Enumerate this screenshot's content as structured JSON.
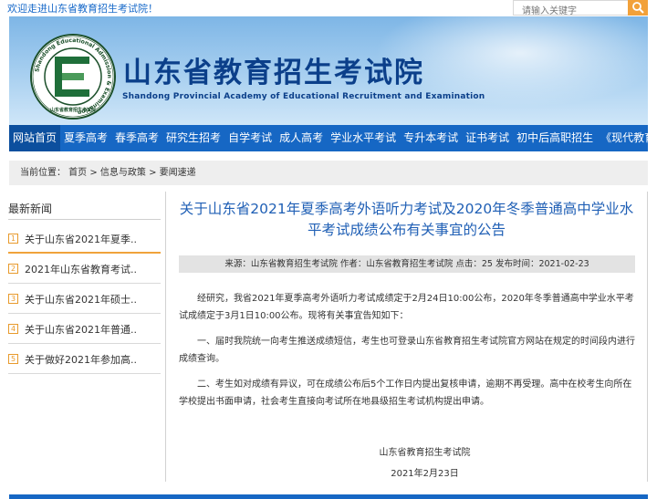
{
  "topbar": {
    "welcome": "欢迎走进山东省教育招生考试院！",
    "search_placeholder": "请输入关键字"
  },
  "header": {
    "title_cn": "山东省教育招生考试院",
    "title_en": "Shandong Provincial Academy of Educational Recruitment and Examination",
    "logo_ring_text": "Shandong Educational Admission & Examination",
    "logo_seal_text": "山东省教育招生考试院",
    "logo_letter": "E"
  },
  "nav": {
    "items": [
      "网站首页",
      "夏季高考",
      "春季高考",
      "研究生招考",
      "自学考试",
      "成人高考",
      "学业水平考试",
      "专升本考试",
      "证书考试",
      "初中后高职招生",
      "《现代教育》"
    ]
  },
  "breadcrumb": {
    "text": "当前位置：  首页 > 信息与政策 > 要闻速递"
  },
  "sidebar": {
    "title": "最新新闻",
    "items": [
      {
        "num": "1",
        "label": "关于山东省2021年夏季.."
      },
      {
        "num": "2",
        "label": "2021年山东省教育考试.."
      },
      {
        "num": "3",
        "label": "关于山东省2021年硕士.."
      },
      {
        "num": "4",
        "label": "关于山东省2021年普通.."
      },
      {
        "num": "5",
        "label": "关于做好2021年参加高.."
      }
    ]
  },
  "article": {
    "title": "关于山东省2021年夏季高考外语听力考试及2020年冬季普通高中学业水平考试成绩公布有关事宜的公告",
    "meta": "来源：山东省教育招生考试院  作者：山东省教育招生考试院  点击：25  发布时间：2021-02-23",
    "paragraphs": [
      "经研究，我省2021年夏季高考外语听力考试成绩定于2月24日10:00公布，2020年冬季普通高中学业水平考试成绩定于3月1日10:00公布。现将有关事宜告知如下：",
      "一、届时我院统一向考生推送成绩短信，考生也可登录山东省教育招生考试院官方网站在规定的时间段内进行成绩查询。",
      "二、考生如对成绩有异议，可在成绩公布后5个工作日内提出复核申请，逾期不再受理。高中在校考生向所在学校提出书面申请，社会考生直接向考试所在地县级招生考试机构提出申请。"
    ],
    "signature": "山东省教育招生考试院",
    "date": "2021年2月23日"
  },
  "colors": {
    "nav_blue": "#1667c4",
    "title_blue": "#1f5fb5",
    "accent_orange": "#f0a33b"
  }
}
